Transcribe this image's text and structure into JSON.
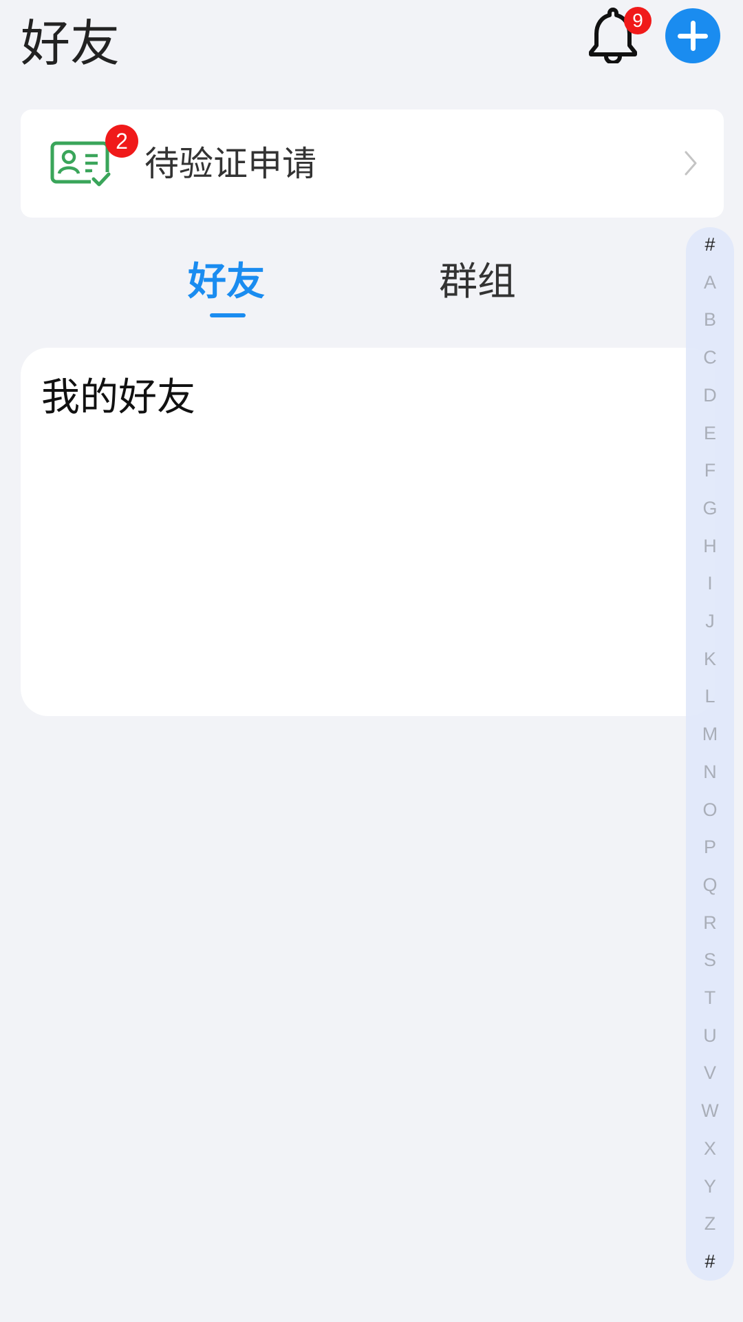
{
  "header": {
    "title": "好友",
    "notification_count": "9"
  },
  "verify_card": {
    "label": "待验证申请",
    "badge_count": "2"
  },
  "tabs": [
    {
      "label": "好友",
      "active": true
    },
    {
      "label": "群组",
      "active": false
    }
  ],
  "friends_card": {
    "title": "我的好友"
  },
  "index_letters": [
    "#",
    "A",
    "B",
    "C",
    "D",
    "E",
    "F",
    "G",
    "H",
    "I",
    "J",
    "K",
    "L",
    "M",
    "N",
    "O",
    "P",
    "Q",
    "R",
    "S",
    "T",
    "U",
    "V",
    "W",
    "X",
    "Y",
    "Z",
    "#"
  ],
  "colors": {
    "accent": "#1a8cf0",
    "badge": "#f01a1a",
    "verify_icon": "#3aa55a",
    "background": "#f2f3f7"
  },
  "icons": {
    "notification": "bell-icon",
    "add": "plus-icon",
    "verify": "id-card-check-icon",
    "arrow": "chevron-right-icon"
  }
}
